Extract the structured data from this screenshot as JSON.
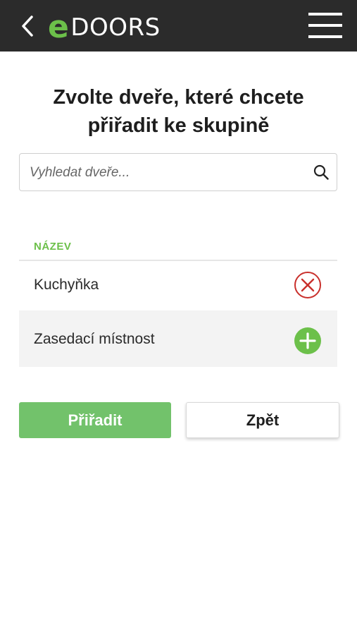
{
  "header": {
    "logo_e": "e",
    "logo_rest": "DOORS",
    "back_icon": "chevron-left-icon",
    "menu_icon": "hamburger-menu-icon",
    "background": "#2b2b2b",
    "accent": "#6cc04a"
  },
  "title": {
    "line1": "Zvolte dveře, které chcete",
    "line2": "přiřadit ke skupině"
  },
  "search": {
    "placeholder": "Vyhledat dveře...",
    "value": "",
    "icon": "search-icon"
  },
  "table": {
    "column_header": "NÁZEV",
    "rows": [
      {
        "label": "Kuchyňka",
        "action_icon": "remove-circle-icon",
        "action_color": "#c9302c"
      },
      {
        "label": "Zasedací místnost",
        "action_icon": "add-circle-icon",
        "action_color": "#6cc04a"
      }
    ]
  },
  "actions": {
    "assign_label": "Přiřadit",
    "back_label": "Zpět",
    "assign_color": "#72c26b"
  }
}
